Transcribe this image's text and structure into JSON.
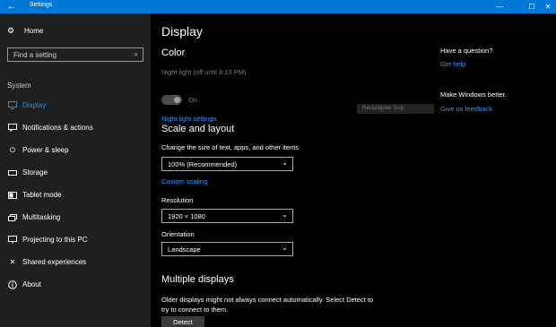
{
  "window": {
    "title": "Settings",
    "controls": {
      "minimize": "—",
      "maximize": "☐",
      "close": "✕"
    }
  },
  "sidebar": {
    "home_label": "Home",
    "search_placeholder": "Find a setting",
    "section_label": "System",
    "items": [
      {
        "label": "Display",
        "icon": "monitor-icon",
        "active": true
      },
      {
        "label": "Notifications & actions",
        "icon": "notifications-icon"
      },
      {
        "label": "Power & sleep",
        "icon": "power-icon"
      },
      {
        "label": "Storage",
        "icon": "storage-icon"
      },
      {
        "label": "Tablet mode",
        "icon": "tablet-icon"
      },
      {
        "label": "Multitasking",
        "icon": "multitasking-icon"
      },
      {
        "label": "Projecting to this PC",
        "icon": "projecting-icon"
      },
      {
        "label": "Shared experiences",
        "icon": "shared-icon"
      },
      {
        "label": "About",
        "icon": "info-icon"
      }
    ]
  },
  "main": {
    "title": "Display",
    "color": {
      "heading": "Color",
      "night_light_status": "Night light (off until 8:13 PM)",
      "toggle_state": "On",
      "night_light_settings_link": "Night light settings"
    },
    "scale": {
      "heading": "Scale and layout",
      "size_label": "Change the size of text, apps, and other items",
      "size_value": "100% (Recommended)",
      "custom_scaling_link": "Custom scaling",
      "resolution_label": "Resolution",
      "resolution_value": "1920 × 1080",
      "orientation_label": "Orientation",
      "orientation_value": "Landscape"
    },
    "multiple": {
      "heading": "Multiple displays",
      "description": "Older displays might not always connect automatically. Select Detect to try to connect to them.",
      "detect_button": "Detect"
    }
  },
  "right_panel": {
    "question": "Have a question?",
    "get_help_link": "Get help",
    "better": "Make Windows better.",
    "feedback_link": "Give us feedback"
  },
  "ghost_overlay_text": "Rectangular Snip",
  "colors": {
    "accent": "#0078d7",
    "link": "#3a96ff",
    "sidebar_bg": "#1f1f1f",
    "main_bg": "#000000"
  }
}
